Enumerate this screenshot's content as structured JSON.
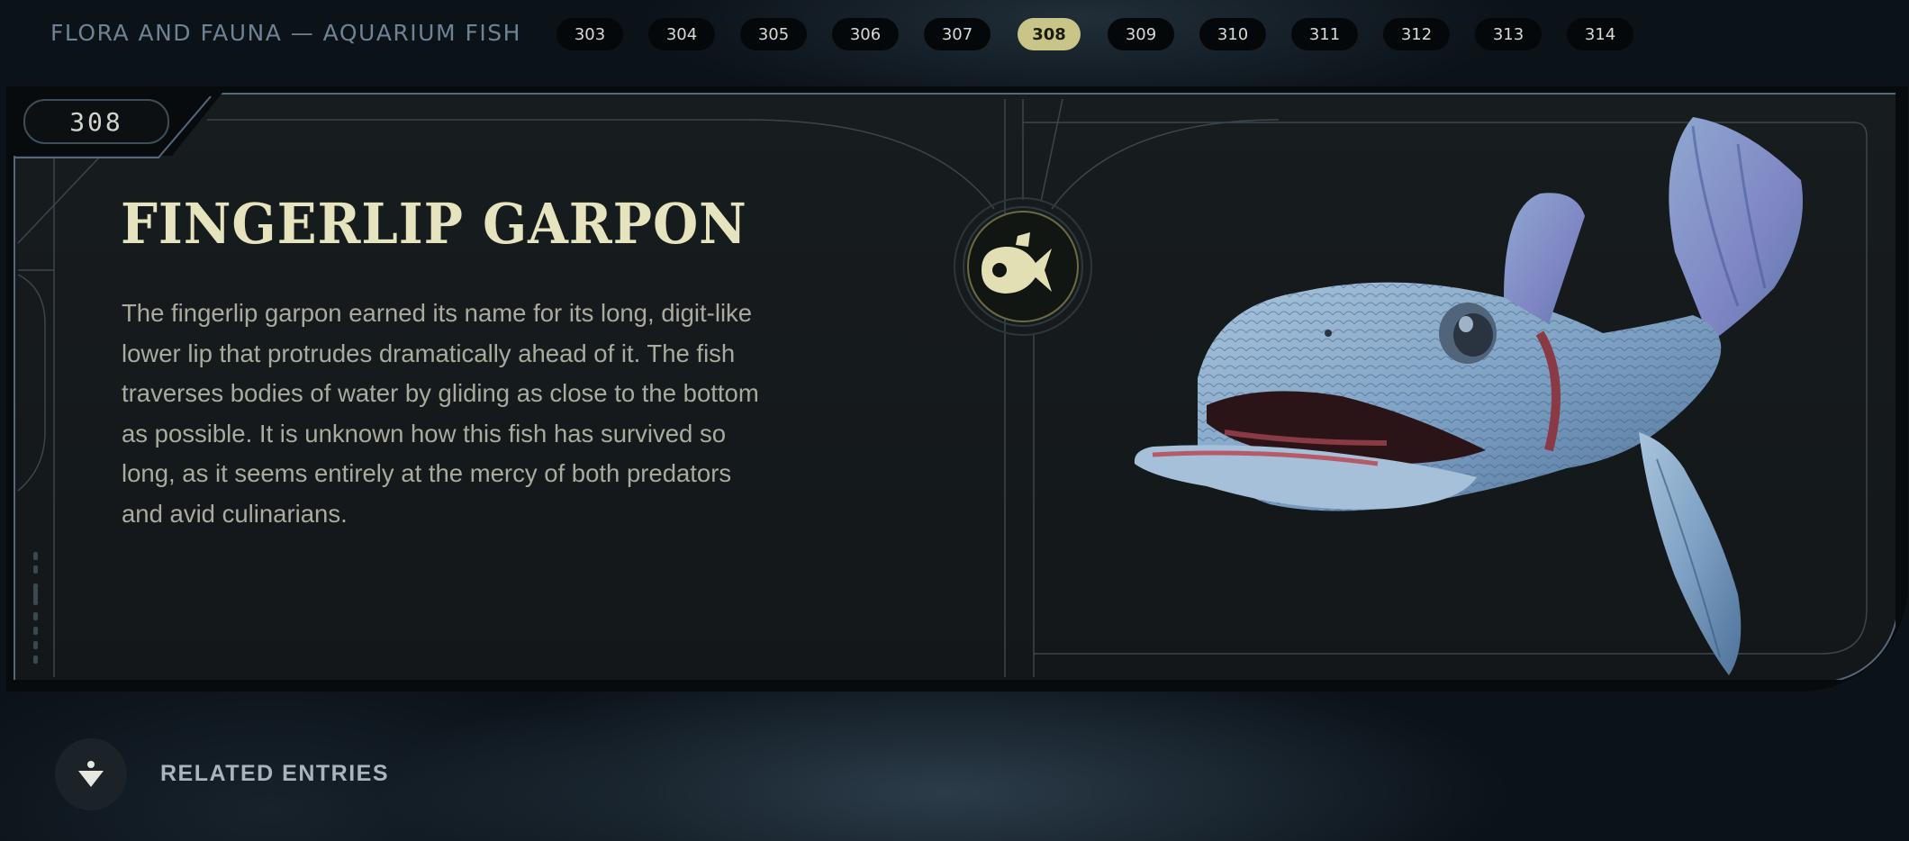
{
  "header": {
    "breadcrumb": "FLORA AND FAUNA — AQUARIUM FISH",
    "entries": [
      "303",
      "304",
      "305",
      "306",
      "307",
      "308",
      "309",
      "310",
      "311",
      "312",
      "313",
      "314"
    ],
    "active_entry": "308"
  },
  "entry": {
    "number": "308",
    "title": "FINGERLIP GARPON",
    "description": "The fingerlip garpon earned its name for its long, digit-like lower lip that protrudes dramatically ahead of it. The fish traverses bodies of water by gliding as close to the bottom as possible. It is unknown how this fish has survived so long, as it seems entirely at the mercy of both predators and avid culinarians.",
    "category_icon": "fish-icon",
    "image_icon": "fingerlip-garpon-illustration"
  },
  "footer": {
    "related_label": "RELATED ENTRIES",
    "related_icon": "figure-down-icon"
  },
  "colors": {
    "accent": "#c9c488",
    "title": "#e6e3bf",
    "body_text": "#a8ab9d",
    "panel_border": "#55687a",
    "fish_blue": "#7fa2c4"
  }
}
